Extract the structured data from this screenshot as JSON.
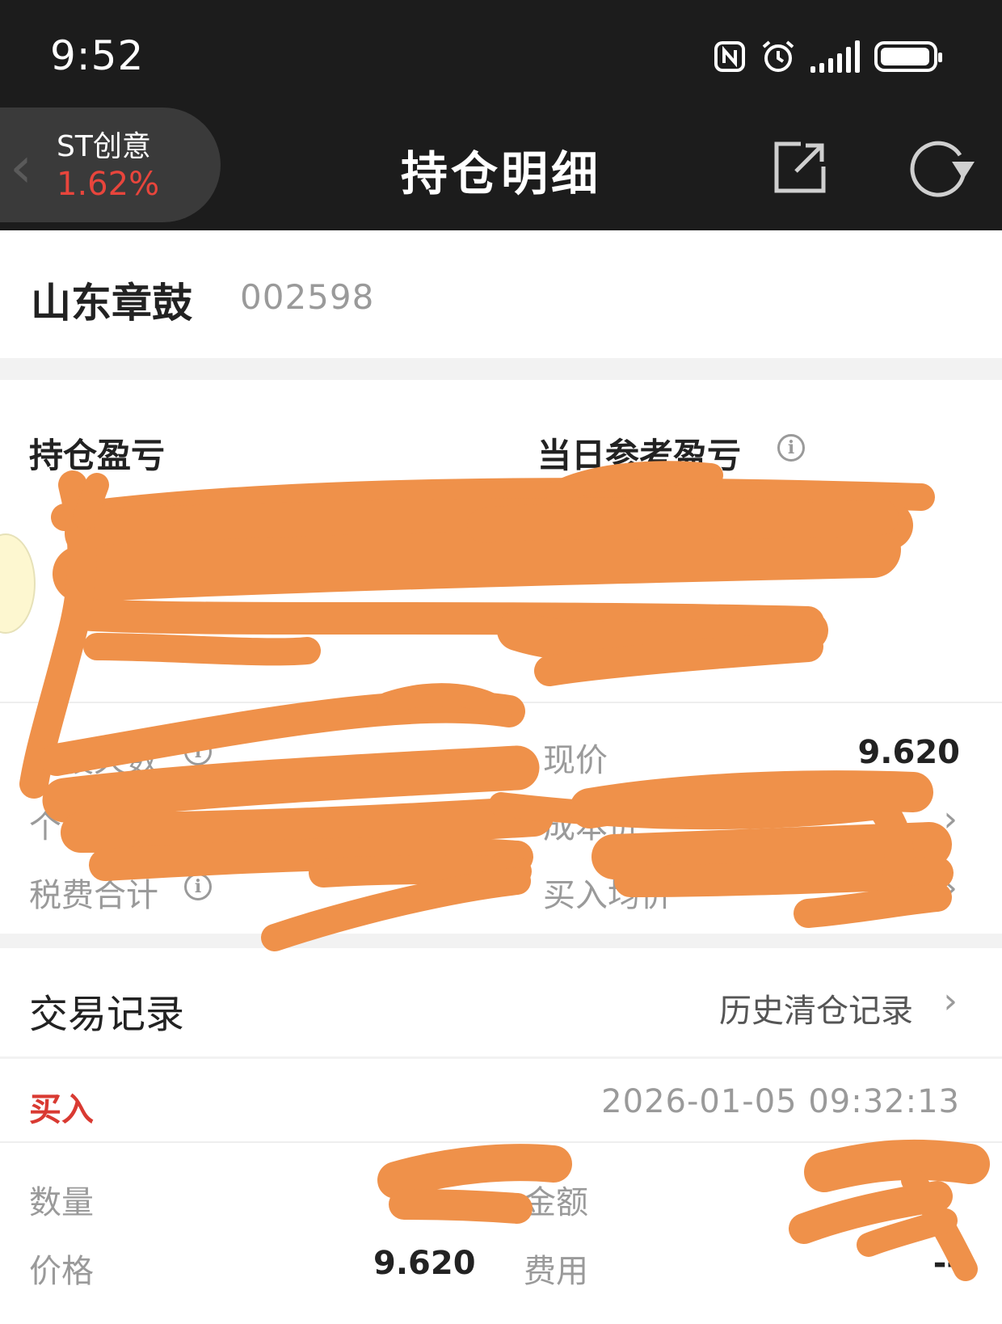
{
  "status_bar": {
    "time": "9:52"
  },
  "nav": {
    "stock_chip": {
      "name": "ST创意",
      "change": "1.62%"
    },
    "title": "持仓明细"
  },
  "stock": {
    "name": "山东章鼓",
    "code": "002598"
  },
  "holdings": {
    "pnl_label": "持仓盈亏",
    "daily_pnl_label": "当日参考盈亏",
    "holding_days_label": "持股天数",
    "price_label": "现价",
    "price_value": "9.620",
    "shares_label": "个股",
    "cost_label": "成本价",
    "fees_label": "税费合计",
    "avg_buy_label": "买入均价"
  },
  "trade_record": {
    "title": "交易记录",
    "history_link": "历史清仓记录",
    "items": [
      {
        "type": "买入",
        "datetime": "2026-01-05 09:32:13",
        "quantity_label": "数量",
        "amount_label": "金额",
        "price_label": "价格",
        "price_value": "9.620",
        "fee_label": "费用",
        "fee_value": "--"
      }
    ]
  },
  "colors": {
    "topbar": "#1c1c1c",
    "up_red": "#e8453c",
    "buy_red": "#d93a32",
    "redaction_orange": "#ef914a"
  }
}
